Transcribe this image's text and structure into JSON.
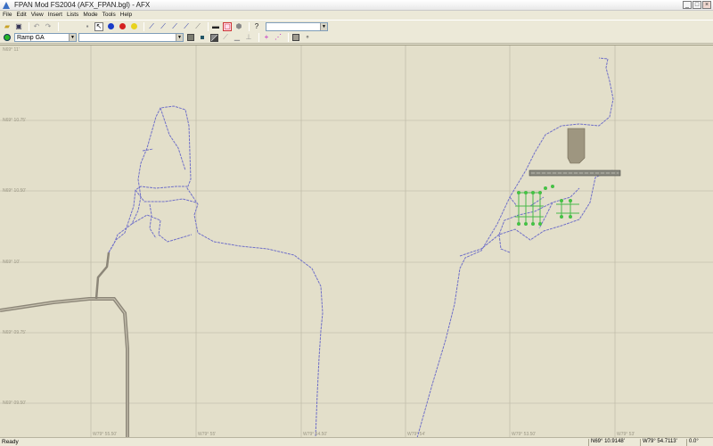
{
  "window": {
    "title": "FPAN Mod FS2004 (AFX_FPAN.bgl) - AFX"
  },
  "menu": [
    "File",
    "Edit",
    "View",
    "Insert",
    "Lists",
    "Mode",
    "Tools",
    "Help"
  ],
  "toolbar": {
    "object_select": "",
    "layer_select": "Ramp GA",
    "object_filter": ""
  },
  "map": {
    "background": "#e3dfca",
    "lat_labels": [
      "N69° 11'",
      "N69° 10.75'",
      "N69° 10.50'",
      "N69° 10'",
      "N69° 09.75'",
      "N69° 09.50'"
    ],
    "lon_labels": [
      "W79° 55.50'",
      "W79° 55'",
      "W79° 54.50'",
      "W79° 54'",
      "W79° 53.50'",
      "W79° 53'"
    ]
  },
  "status": {
    "ready": "Ready",
    "lat": "N69° 10.9148'",
    "lon": "W79° 54.7113'",
    "heading": "0.0°"
  }
}
